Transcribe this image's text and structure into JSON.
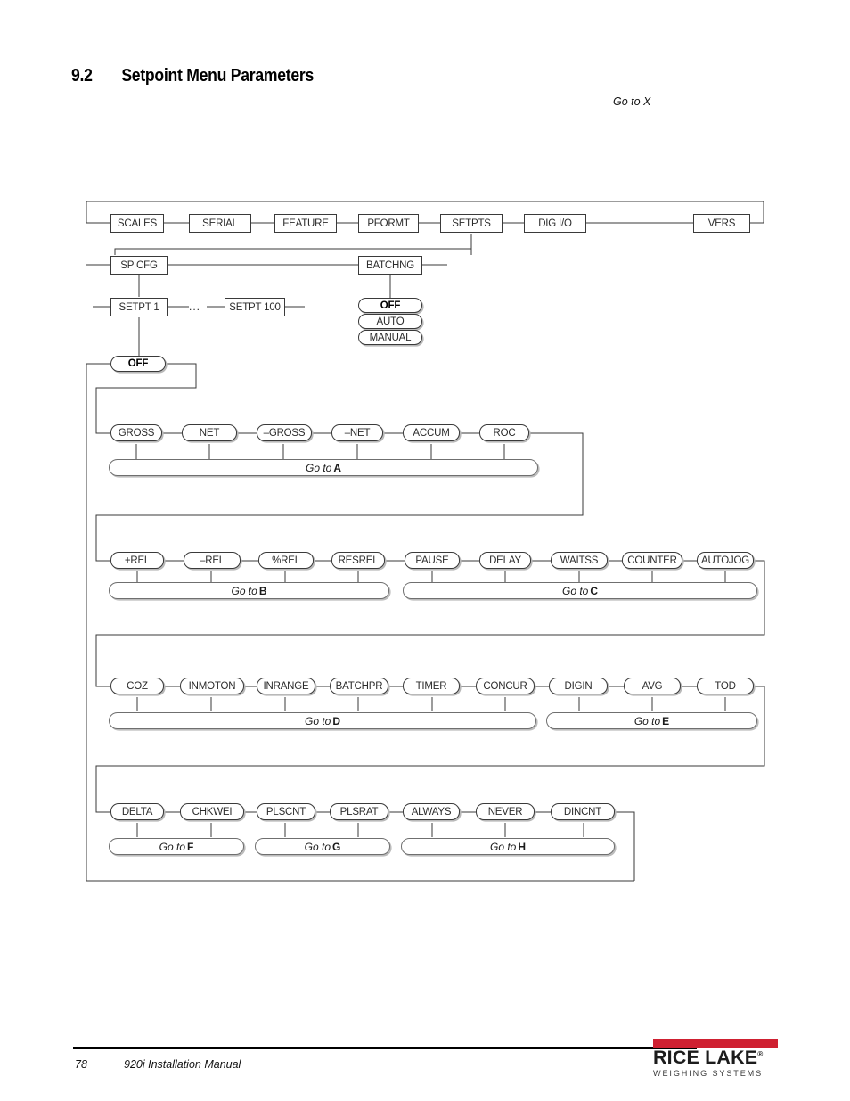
{
  "heading": {
    "number": "9.2",
    "title": "Setpoint Menu Parameters"
  },
  "goto_x": "Go to X",
  "diagram": {
    "top_menu": [
      {
        "label": "SCALES"
      },
      {
        "label": "SERIAL"
      },
      {
        "label": "FEATURE"
      },
      {
        "label": "PFORMT"
      },
      {
        "label": "SETPTS"
      },
      {
        "label": "DIG I/O"
      },
      {
        "label": "VERS"
      }
    ],
    "setpts_children": [
      {
        "label": "SP CFG"
      },
      {
        "label": "BATCHNG"
      }
    ],
    "spcfg_children": [
      {
        "label": "SETPT 1"
      },
      {
        "label": "SETPT 100"
      }
    ],
    "ellipsis": "...",
    "batching_options": [
      {
        "label": "OFF",
        "bold": true
      },
      {
        "label": "AUTO",
        "bold": false
      },
      {
        "label": "MANUAL",
        "bold": false
      }
    ],
    "setpt_kind_off": {
      "label": "OFF",
      "bold": true
    },
    "rows": [
      {
        "name": "weight-source-row",
        "nodes": [
          "GROSS",
          "NET",
          "–GROSS",
          "–NET",
          "ACCUM",
          "ROC"
        ],
        "gotos": [
          {
            "prefix": "Go to ",
            "letter": "A"
          }
        ]
      },
      {
        "name": "relative-timer-row",
        "nodes": [
          "+REL",
          "–REL",
          "%REL",
          "RESREL",
          "PAUSE",
          "DELAY",
          "WAITSS",
          "COUNTER",
          "AUTOJOG"
        ],
        "gotos": [
          {
            "prefix": "Go to ",
            "letter": "B"
          },
          {
            "prefix": "Go to ",
            "letter": "C"
          }
        ]
      },
      {
        "name": "status-row",
        "nodes": [
          "COZ",
          "INMOTON",
          "INRANGE",
          "BATCHPR",
          "TIMER",
          "CONCUR",
          "DIGIN",
          "AVG",
          "TOD"
        ],
        "gotos": [
          {
            "prefix": "Go to ",
            "letter": "D"
          },
          {
            "prefix": "Go to ",
            "letter": "E"
          }
        ]
      },
      {
        "name": "delta-pulse-row",
        "nodes": [
          "DELTA",
          "CHKWEI",
          "PLSCNT",
          "PLSRAT",
          "ALWAYS",
          "NEVER",
          "DINCNT"
        ],
        "gotos": [
          {
            "prefix": "Go to ",
            "letter": "F"
          },
          {
            "prefix": "Go to ",
            "letter": "G"
          },
          {
            "prefix": "Go to ",
            "letter": "H"
          }
        ]
      }
    ]
  },
  "footer": {
    "page": "78",
    "manual": "920i Installation Manual",
    "logo_name": "RICE LAKE",
    "logo_registered": "®",
    "logo_tagline": "WEIGHING SYSTEMS",
    "logo_bar_color": "#cf2031"
  }
}
